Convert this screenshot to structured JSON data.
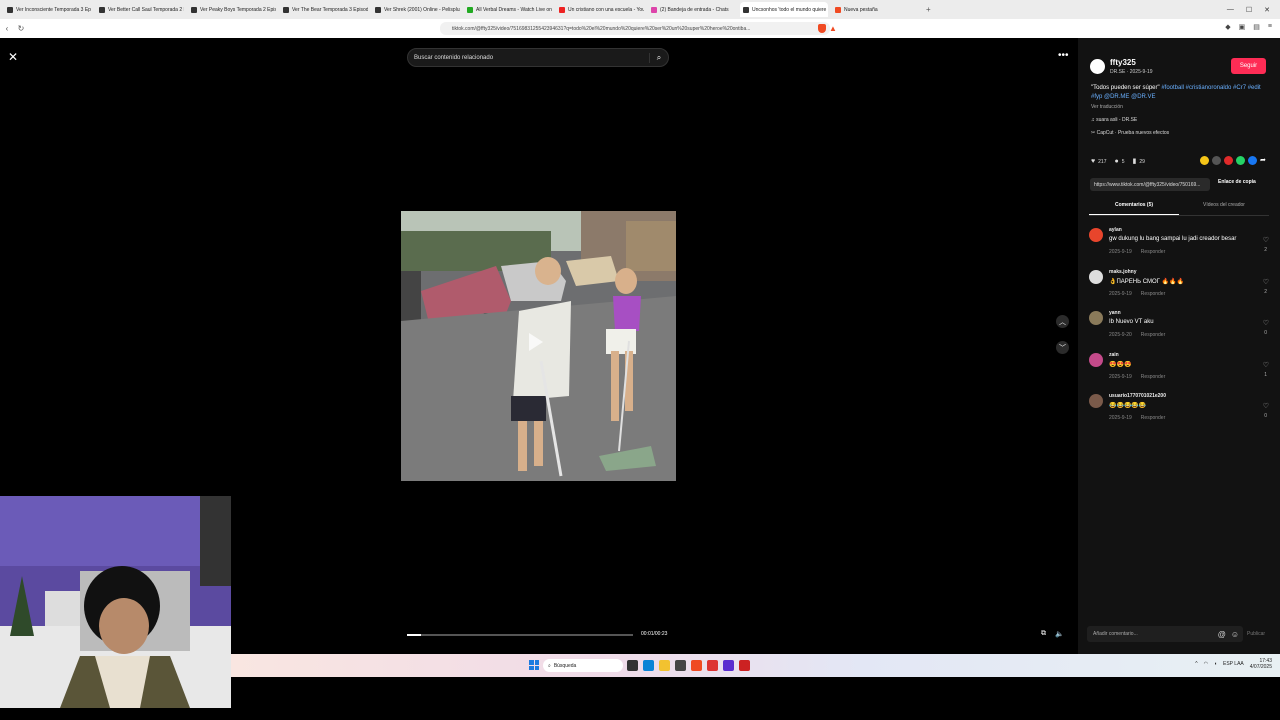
{
  "browser": {
    "tabs": [
      {
        "label": "Ver Inconsciente Temporada 3 Ep",
        "fav": "dark"
      },
      {
        "label": "Ver Better Call Saul Temporada 2 Ep",
        "fav": "dark"
      },
      {
        "label": "Ver Peaky Boys Temporada 2 Episo",
        "fav": "dark"
      },
      {
        "label": "Ver The Bear Temporada 3 Episodio",
        "fav": "dark"
      },
      {
        "label": "Ver Shrek (2001) Online - Pelisplus",
        "fav": "dark"
      },
      {
        "label": "All Verbal Dreams - Watch Live on Ki",
        "fav": "green"
      },
      {
        "label": "Un cristiano con una escuela - YouTu",
        "fav": "red"
      },
      {
        "label": "(2) Bandeja de entrada - Chats",
        "fav": "pink"
      },
      {
        "label": "Uncsonhos 'todo el mundo quiere",
        "fav": "dark",
        "active": true
      },
      {
        "label": "Nueva pestaña",
        "fav": "brave"
      }
    ],
    "url": "tiktok.com/@ffty325/video/7516983125542394631?q=todo%20el%20mundo%20quiere%20ser%20un%20super%20heroe%20ontiba...",
    "tab_plus": "+"
  },
  "page": {
    "close": "✕",
    "search_placeholder": "Buscar contenido relacionado",
    "search_icon": "⌕",
    "more": "•••",
    "up": "︿",
    "down": "﹀",
    "timecode": "00:01/00:23",
    "progress": 0.06
  },
  "panel": {
    "username": "ffty325",
    "subline": "DR.SE · 2025-9-19",
    "follow": "Seguir",
    "desc_text": "\"Todos pueden ser súper\"",
    "desc_tags": "#football #cristianoronaldo #Cr7 #edit #fyp @DR.ME @DR.VE",
    "translate": "Ver traducción",
    "music": "♫ suara asli - DR.SE",
    "capcut": "✂ CapCut · Prueba nuevos efectos",
    "likes": "217",
    "comments": "5",
    "saves": "29",
    "link": "https://www.tiktok.com/@ffty325/video/750169...",
    "copy_link": "Enlace de copia",
    "tab_comments": "Comentarios (5)",
    "tab_videos": "Vídeos del creador"
  },
  "comments": [
    {
      "name": "aylan",
      "text": "gw dukung lu bang sampai lu jadi creador besar",
      "date": "2025-9-19",
      "reply": "Responder",
      "likes": "2",
      "color": "#e8452c"
    },
    {
      "name": "maks.johny",
      "text": "👌ПАРЕНЬ СМОГ 🔥🔥🔥",
      "date": "2025-9-19",
      "reply": "Responder",
      "likes": "2",
      "color": "#ddd"
    },
    {
      "name": "yann",
      "text": "Ib Nuevo VT aku",
      "date": "2025-9-20",
      "reply": "Responder",
      "likes": "0",
      "color": "#8a7a5a"
    },
    {
      "name": "zain",
      "text": "😍😍😍",
      "date": "2025-9-19",
      "reply": "Responder",
      "likes": "1",
      "color": "#c44a8a"
    },
    {
      "name": "usuario1770701021e200",
      "text": "😂😂😂😂😂",
      "date": "2025-9-19",
      "reply": "Responder",
      "likes": "0",
      "color": "#7a5a4a"
    }
  ],
  "comment_box": {
    "placeholder": "Añadir comentario...",
    "publish": "Publicar"
  },
  "taskbar": {
    "search": "Búsqueda",
    "lang": "ESP LAA",
    "time": "17:43",
    "date": "4/07/2025"
  }
}
